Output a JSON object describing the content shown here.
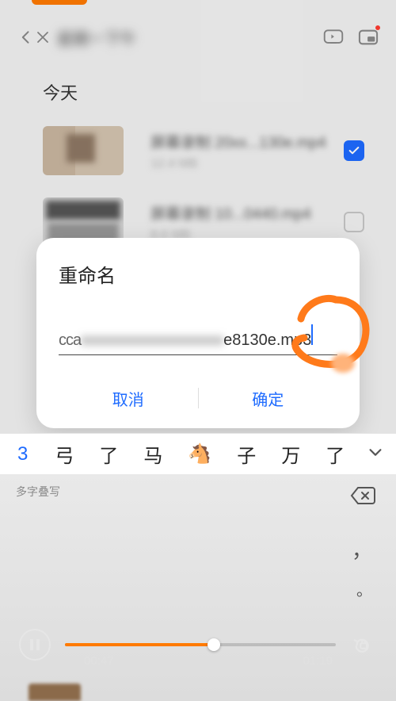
{
  "header": {
    "title_blur": "星期一下午"
  },
  "section": {
    "today": "今天"
  },
  "files": [
    {
      "name_blur": "屏幕录制 20xx...",
      "name_suffix": "130e.mp4",
      "sub_blur": "12.4 MB",
      "checked": true
    },
    {
      "name_blur": "屏幕录制 10...",
      "name_suffix": "0440.mp4",
      "sub_blur": "8.6 MB",
      "checked": false
    }
  ],
  "dialog": {
    "title": "重命名",
    "input_prefix": "cca",
    "input_blur": "xxxxxxxxxxxxxxxxxx",
    "input_suffix": "e8130e.mp3",
    "cancel": "取消",
    "ok": "确定"
  },
  "candidates": {
    "num": "3",
    "items": [
      "弓",
      "了",
      "马",
      "🐴",
      "子",
      "万",
      "了"
    ],
    "expand": "⌄"
  },
  "handwriting": {
    "hint": "多字叠写"
  },
  "video": {
    "current": "00:47",
    "total": "01:19",
    "progress_pct": 55
  }
}
